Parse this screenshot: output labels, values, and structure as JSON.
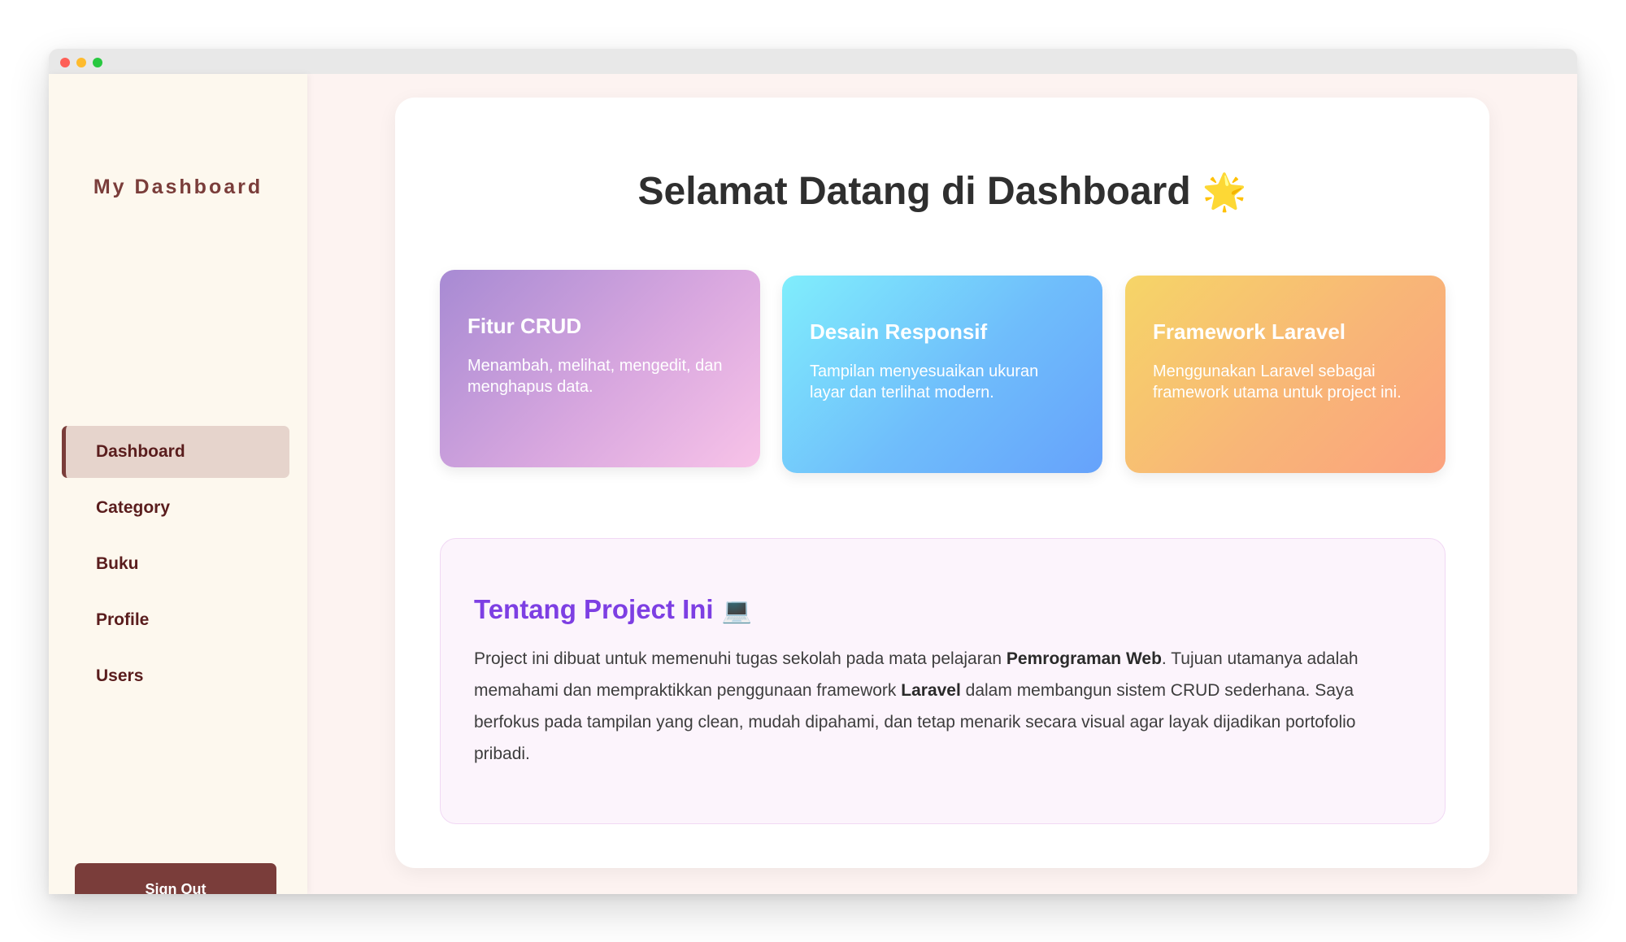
{
  "sidebar": {
    "brand": "My Dashboard",
    "items": [
      {
        "label": "Dashboard",
        "active": true
      },
      {
        "label": "Category"
      },
      {
        "label": "Buku"
      },
      {
        "label": "Profile"
      },
      {
        "label": "Users"
      }
    ],
    "signout_label": "Sign Out"
  },
  "main": {
    "title": "Selamat Datang di Dashboard",
    "title_emoji": "🌟",
    "features": [
      {
        "title": "Fitur CRUD",
        "desc": "Menambah, melihat, mengedit, dan menghapus data.",
        "gradient": [
          "#a78ad3",
          "#f8c3e8"
        ]
      },
      {
        "title": "Desain Responsif",
        "desc": "Tampilan menyesuaikan ukuran layar dan terlihat modern.",
        "gradient": [
          "#80eefc",
          "#66a2fb"
        ]
      },
      {
        "title": "Framework Laravel",
        "desc": "Menggunakan Laravel sebagai framework utama untuk project ini.",
        "gradient": [
          "#f6d567",
          "#fba27e"
        ]
      }
    ],
    "about": {
      "title": "Tentang Project Ini",
      "title_emoji": "💻",
      "text_1": "Project ini dibuat untuk memenuhi tugas sekolah pada mata pelajaran ",
      "bold_1": "Pemrograman Web",
      "text_2": ". Tujuan utamanya adalah memahami dan mempraktikkan penggunaan framework ",
      "bold_2": "Laravel",
      "text_3": " dalam membangun sistem CRUD sederhana. Saya berfokus pada tampilan yang clean, mudah dipahami, dan tetap menarik secara visual agar layak dijadikan portofolio pribadi."
    }
  },
  "colors": {
    "accent": "#7a3d3a",
    "sidebar_bg": "#fdf8ee",
    "page_bg": "#fdf3f1",
    "about_title": "#7d3fe3"
  }
}
